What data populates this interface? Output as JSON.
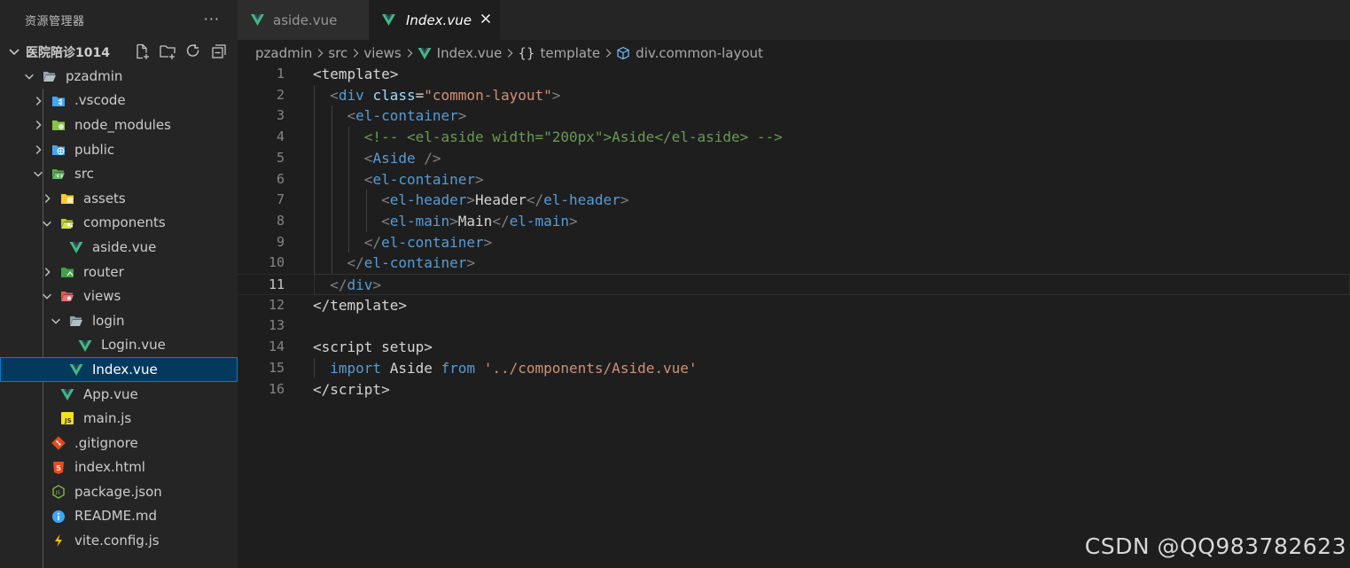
{
  "sidebar": {
    "title": "资源管理器",
    "more": "···",
    "folder_name": "医院陪诊1014",
    "actions": [
      "new-file-icon",
      "new-folder-icon",
      "refresh-icon",
      "collapse-all-icon"
    ],
    "tree": [
      {
        "label": "pzadmin",
        "icon": "folder-open-icon"
      },
      {
        "label": ".vscode",
        "icon": "vscode-folder-icon"
      },
      {
        "label": "node_modules",
        "icon": "node-folder-icon"
      },
      {
        "label": "public",
        "icon": "globe-folder-icon"
      },
      {
        "label": "src",
        "icon": "src-folder-icon"
      },
      {
        "label": "assets",
        "icon": "assets-folder-icon"
      },
      {
        "label": "components",
        "icon": "components-folder-icon"
      },
      {
        "label": "aside.vue",
        "icon": "vue-file-icon"
      },
      {
        "label": "router",
        "icon": "router-folder-icon"
      },
      {
        "label": "views",
        "icon": "views-folder-icon"
      },
      {
        "label": "login",
        "icon": "folder-open-icon"
      },
      {
        "label": "Login.vue",
        "icon": "vue-file-icon"
      },
      {
        "label": "Index.vue",
        "icon": "vue-file-icon"
      },
      {
        "label": "App.vue",
        "icon": "vue-file-icon"
      },
      {
        "label": "main.js",
        "icon": "js-file-icon"
      },
      {
        "label": ".gitignore",
        "icon": "git-file-icon"
      },
      {
        "label": "index.html",
        "icon": "html-file-icon"
      },
      {
        "label": "package.json",
        "icon": "node-json-file-icon"
      },
      {
        "label": "README.md",
        "icon": "info-file-icon"
      },
      {
        "label": "vite.config.js",
        "icon": "vite-file-icon"
      }
    ]
  },
  "tabs": [
    {
      "label": "aside.vue",
      "active": false
    },
    {
      "label": "Index.vue",
      "active": true,
      "close": "×"
    }
  ],
  "breadcrumb": {
    "items": [
      "pzadmin",
      "src",
      "views",
      "Index.vue",
      "template",
      "div.common-layout"
    ],
    "braces": "{}"
  },
  "editor": {
    "line_numbers": [
      "1",
      "2",
      "3",
      "4",
      "5",
      "6",
      "7",
      "8",
      "9",
      "10",
      "11",
      "12",
      "13",
      "14",
      "15",
      "16"
    ],
    "current_line": 11
  },
  "watermark": "CSDN @QQ983782623",
  "colors": {
    "accent": "#007fd4",
    "vue": "#41b883",
    "tag_name": "#569cd6",
    "attribute": "#9cdcfe",
    "string": "#ce9178",
    "comment": "#6a9955",
    "component": "#4ec9b0"
  }
}
